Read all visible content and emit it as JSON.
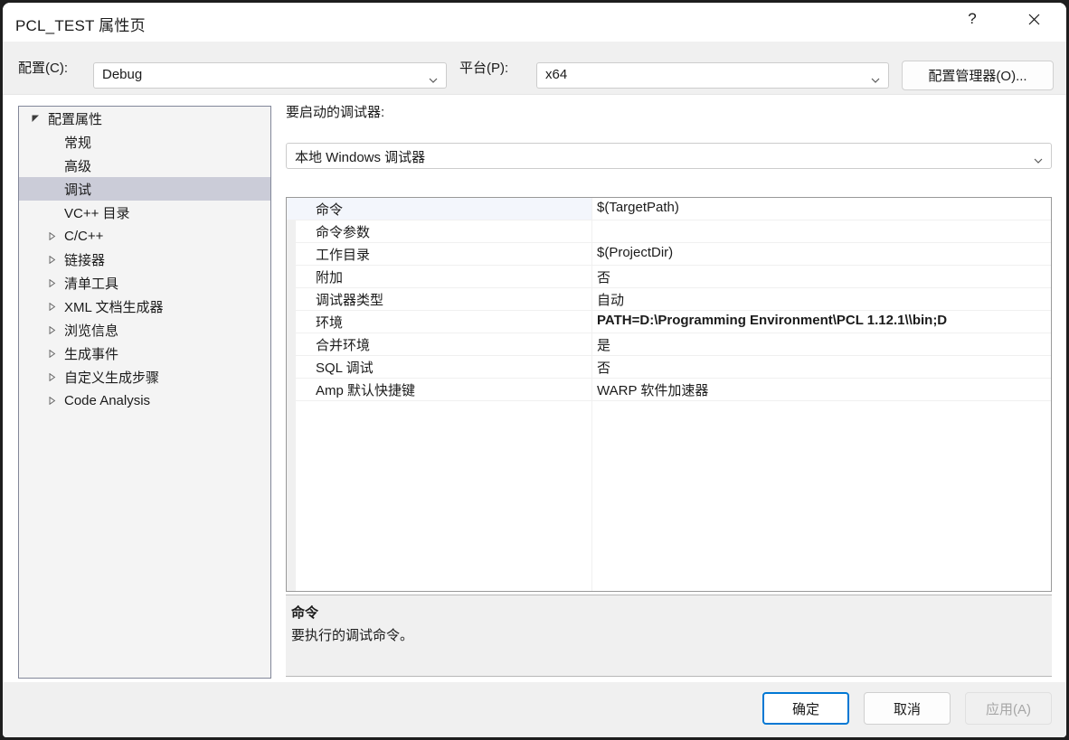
{
  "window": {
    "title": "PCL_TEST 属性页",
    "help_icon": "?",
    "close_icon": "close-icon"
  },
  "config_bar": {
    "config_label": "配置(C):",
    "config_value": "Debug",
    "platform_label": "平台(P):",
    "platform_value": "x64",
    "config_manager_button": "配置管理器(O)..."
  },
  "tree": {
    "items": [
      {
        "label": "配置属性",
        "indent": 0,
        "state": "expanded",
        "selected": false
      },
      {
        "label": "常规",
        "indent": 1,
        "state": "leaf",
        "selected": false
      },
      {
        "label": "高级",
        "indent": 1,
        "state": "leaf",
        "selected": false
      },
      {
        "label": "调试",
        "indent": 1,
        "state": "leaf",
        "selected": true
      },
      {
        "label": "VC++ 目录",
        "indent": 1,
        "state": "leaf",
        "selected": false
      },
      {
        "label": "C/C++",
        "indent": 1,
        "state": "collapsed",
        "selected": false
      },
      {
        "label": "链接器",
        "indent": 1,
        "state": "collapsed",
        "selected": false
      },
      {
        "label": "清单工具",
        "indent": 1,
        "state": "collapsed",
        "selected": false
      },
      {
        "label": "XML 文档生成器",
        "indent": 1,
        "state": "collapsed",
        "selected": false
      },
      {
        "label": "浏览信息",
        "indent": 1,
        "state": "collapsed",
        "selected": false
      },
      {
        "label": "生成事件",
        "indent": 1,
        "state": "collapsed",
        "selected": false
      },
      {
        "label": "自定义生成步骤",
        "indent": 1,
        "state": "collapsed",
        "selected": false
      },
      {
        "label": "Code Analysis",
        "indent": 1,
        "state": "collapsed",
        "selected": false
      }
    ]
  },
  "main": {
    "debugger_label": "要启动的调试器:",
    "debugger_value": "本地 Windows 调试器",
    "properties": [
      {
        "name": "命令",
        "value": "$(TargetPath)",
        "bold": false,
        "selected": true
      },
      {
        "name": "命令参数",
        "value": "",
        "bold": false,
        "selected": false
      },
      {
        "name": "工作目录",
        "value": "$(ProjectDir)",
        "bold": false,
        "selected": false
      },
      {
        "name": "附加",
        "value": "否",
        "bold": false,
        "selected": false
      },
      {
        "name": "调试器类型",
        "value": "自动",
        "bold": false,
        "selected": false
      },
      {
        "name": "环境",
        "value": "PATH=D:\\Programming Environment\\PCL 1.12.1\\\\bin;D",
        "bold": true,
        "selected": false
      },
      {
        "name": "合并环境",
        "value": "是",
        "bold": false,
        "selected": false
      },
      {
        "name": "SQL 调试",
        "value": "否",
        "bold": false,
        "selected": false
      },
      {
        "name": "Amp 默认快捷键",
        "value": "WARP 软件加速器",
        "bold": false,
        "selected": false
      }
    ],
    "description": {
      "title": "命令",
      "body": "要执行的调试命令。"
    }
  },
  "footer": {
    "ok_label": "确定",
    "cancel_label": "取消",
    "apply_label": "应用(A)"
  },
  "colors": {
    "accent": "#0078d4",
    "tree_selection": "#cbccd8",
    "grid_selection": "#f3f6fc",
    "panel_bg": "#f0f0f0"
  }
}
